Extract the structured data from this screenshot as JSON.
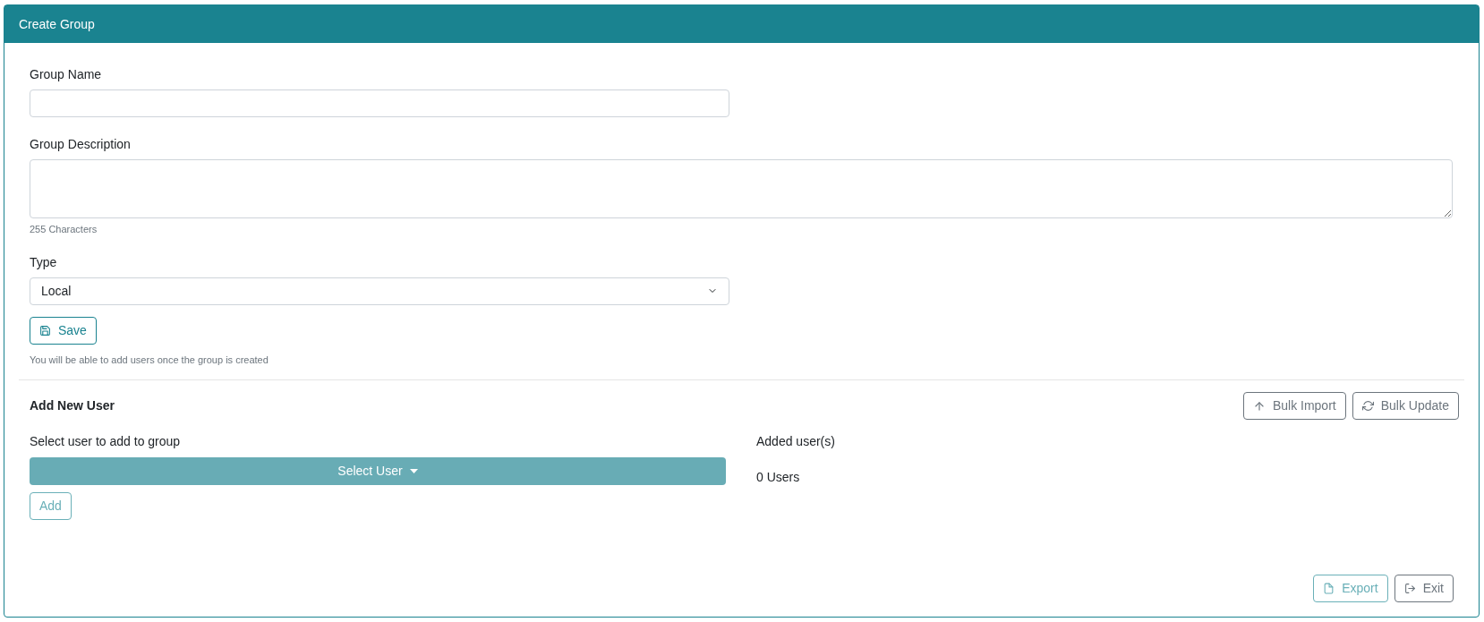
{
  "header": {
    "title": "Create Group"
  },
  "group_name": {
    "label": "Group Name"
  },
  "group_description": {
    "label": "Group Description",
    "hint": "255 Characters"
  },
  "type": {
    "label": "Type",
    "value": "Local"
  },
  "save_button": {
    "label": "Save",
    "disabled": false
  },
  "save_note": "You will be able to add users once the group is created",
  "add_user": {
    "title": "Add New User",
    "actions": [
      {
        "kind": "import",
        "label": "Bulk Import",
        "disabled": false
      },
      {
        "kind": "update",
        "label": "Bulk Update",
        "disabled": false
      }
    ],
    "select_label": "Select user to add to group",
    "select_button": "Select User",
    "add_button": {
      "label": "Add",
      "disabled": true
    },
    "added_label": "Added user(s)",
    "added_count": "0 Users"
  },
  "footer": [
    {
      "kind": "export",
      "label": "Export",
      "disabled": true
    },
    {
      "kind": "exit",
      "label": "Exit",
      "disabled": false
    }
  ]
}
